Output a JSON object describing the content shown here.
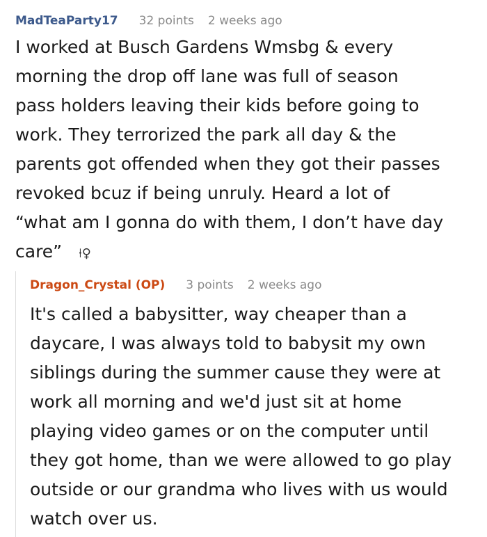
{
  "comments": [
    {
      "username": "MadTeaParty17",
      "points": "32 points",
      "time": "2 weeks ago",
      "lines": [
        "I worked at Busch Gardens Wmsbg & every",
        "morning the drop off lane was full of season",
        "pass holders leaving their kids before going to",
        "work. They terrorized the park all day & the",
        "parents got offended when they got their passes",
        "revoked bcuz if being unruly. Heard a lot of",
        "“what am I gonna do with them, I don’t have day",
        "care”"
      ],
      "trailing_icon": "person-female-icon"
    },
    {
      "username": "Dragon_Crystal (OP)",
      "points": "3 points",
      "time": "2 weeks ago",
      "lines": [
        "It's called a babysitter, way cheaper than a",
        "daycare, I was always told to babysit my own",
        "siblings during the summer cause they were at",
        "work all morning and we'd just sit at home",
        "playing video games or on the computer until",
        "they got home, than we were allowed to go play",
        "outside or our grandma who lives with us would",
        "watch over us."
      ]
    }
  ],
  "colors": {
    "username_top": "#3d5a8c",
    "username_op": "#cc4a14",
    "meta_gray": "#8a8a8a",
    "text": "#1a1a1a"
  }
}
